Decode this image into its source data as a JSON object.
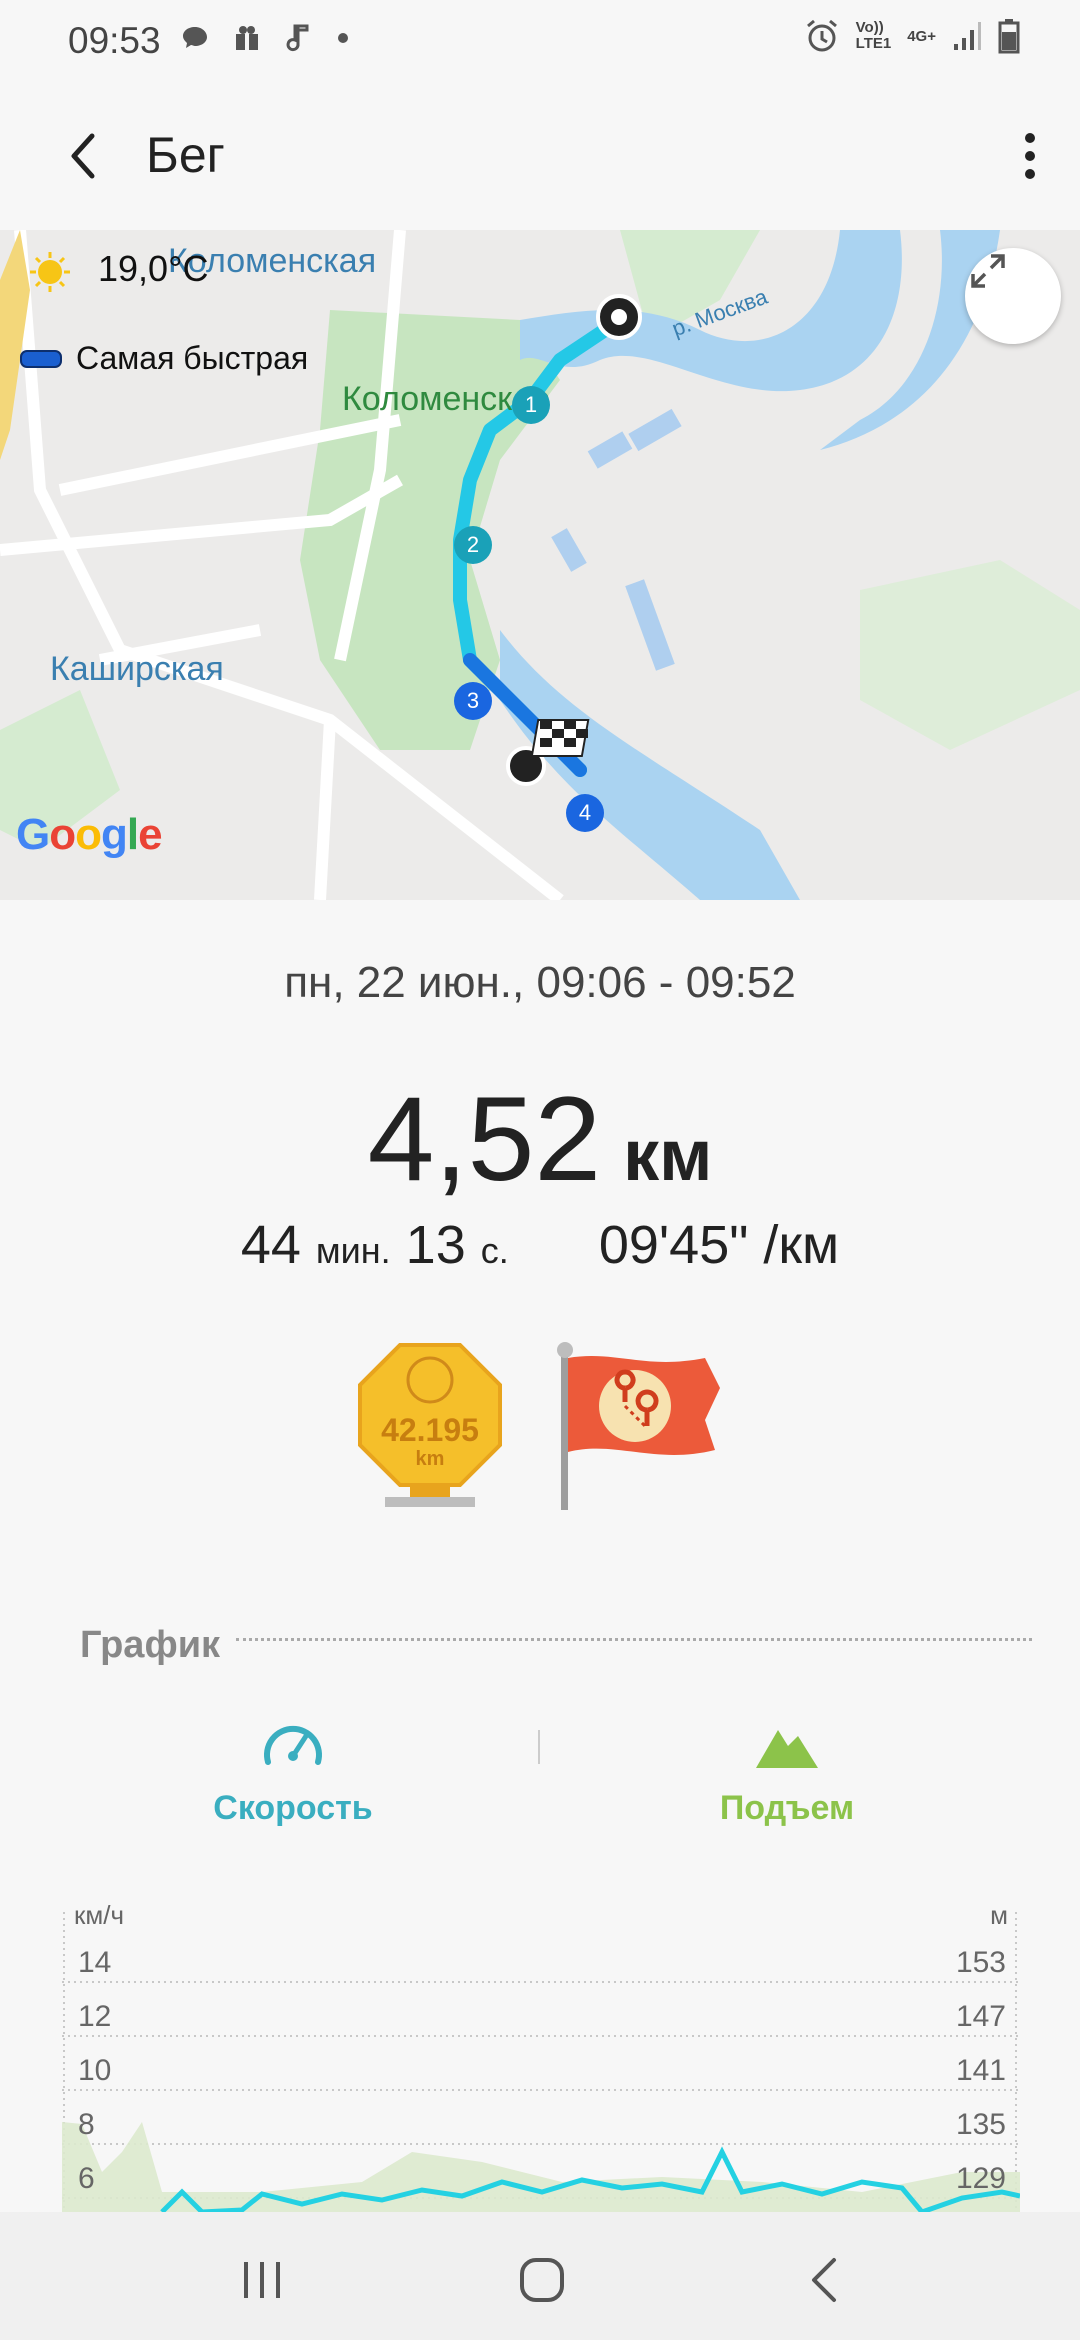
{
  "status_bar": {
    "time": "09:53",
    "left_icons": [
      "chat-icon",
      "gift-icon",
      "music-note-icon",
      "dot-icon"
    ],
    "right_icons": [
      "alarm-icon",
      "volte-lte-icon",
      "4g-icon",
      "signal-icon",
      "battery-icon"
    ],
    "lte_text": "Vo))\nLTE1",
    "net_text": "4G+"
  },
  "app_bar": {
    "title": "Бег"
  },
  "map": {
    "temperature": "19,0°C",
    "legend_label": "Самая быстрая",
    "labels": {
      "kolomenskaya_station": "Коломенская",
      "kolomenskoe_park": "Коломенское",
      "kashirskaya_station": "Каширская",
      "river": "р. Москва"
    },
    "markers": [
      "1",
      "2",
      "3",
      "4"
    ],
    "provider": "Google",
    "route_color": "#24c8e6"
  },
  "workout": {
    "date_range": "пн, 22 июн., 09:06 - 09:52",
    "distance_value": "4,52",
    "distance_unit": "км",
    "duration_min": "44",
    "duration_min_unit": "мин.",
    "duration_sec": "13",
    "duration_sec_unit": "с.",
    "pace": "09'45\" /км",
    "badge_marathon_value": "42.195",
    "badge_marathon_unit": "km"
  },
  "chart_section": {
    "title": "График",
    "tabs": [
      {
        "label": "Скорость",
        "icon": "speedometer-icon",
        "color": "#3aaec0"
      },
      {
        "label": "Подъем",
        "icon": "mountain-icon",
        "color": "#8cc34a"
      }
    ]
  },
  "chart_data": {
    "type": "line",
    "left_unit": "км/ч",
    "right_unit": "м",
    "left_ticks": [
      "14",
      "12",
      "10",
      "8",
      "6"
    ],
    "right_ticks": [
      "153",
      "147",
      "141",
      "135",
      "129"
    ]
  },
  "nav_bar": {
    "buttons": [
      "recents-icon",
      "home-icon",
      "back-icon"
    ]
  }
}
